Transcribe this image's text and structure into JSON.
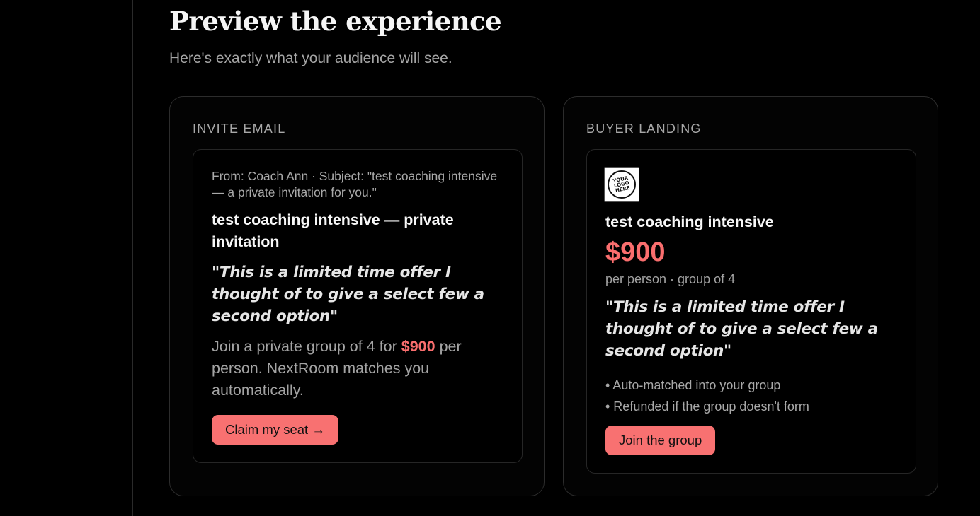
{
  "page": {
    "title": "Preview the experience",
    "subtitle": "Here's exactly what your audience will see."
  },
  "invite_email": {
    "heading": "INVITE EMAIL",
    "meta": "From: Coach Ann · Subject: \"test coaching intensive — a private invitation for you.\"",
    "title": "test coaching intensive — private invitation",
    "quote": "\"This is a limited time offer I thought of to give a select few a second option\"",
    "body_before": "Join a private group of 4 for",
    "body_price": "$900",
    "body_after": "per person. NextRoom matches you automatically.",
    "cta_label": "Claim my seat →"
  },
  "buyer_landing": {
    "heading": "BUYER LANDING",
    "logo_text": "YOUR LOGO HERE",
    "logo_icon": "logo-placeholder-icon",
    "title": "test coaching intensive",
    "price": "$900",
    "price_sub": "per person · group of 4",
    "quote": "\"This is a limited time offer I thought of to give a select few a second option\"",
    "bullets": [
      "• Auto-matched into your group",
      "• Refunded if the group doesn't form"
    ],
    "cta_label": "Join the group"
  },
  "colors": {
    "background": "#000000",
    "accent": "#f87171",
    "price": "#fa6e6e",
    "muted_text": "#a5a5a5",
    "border": "#2c2c2c"
  }
}
